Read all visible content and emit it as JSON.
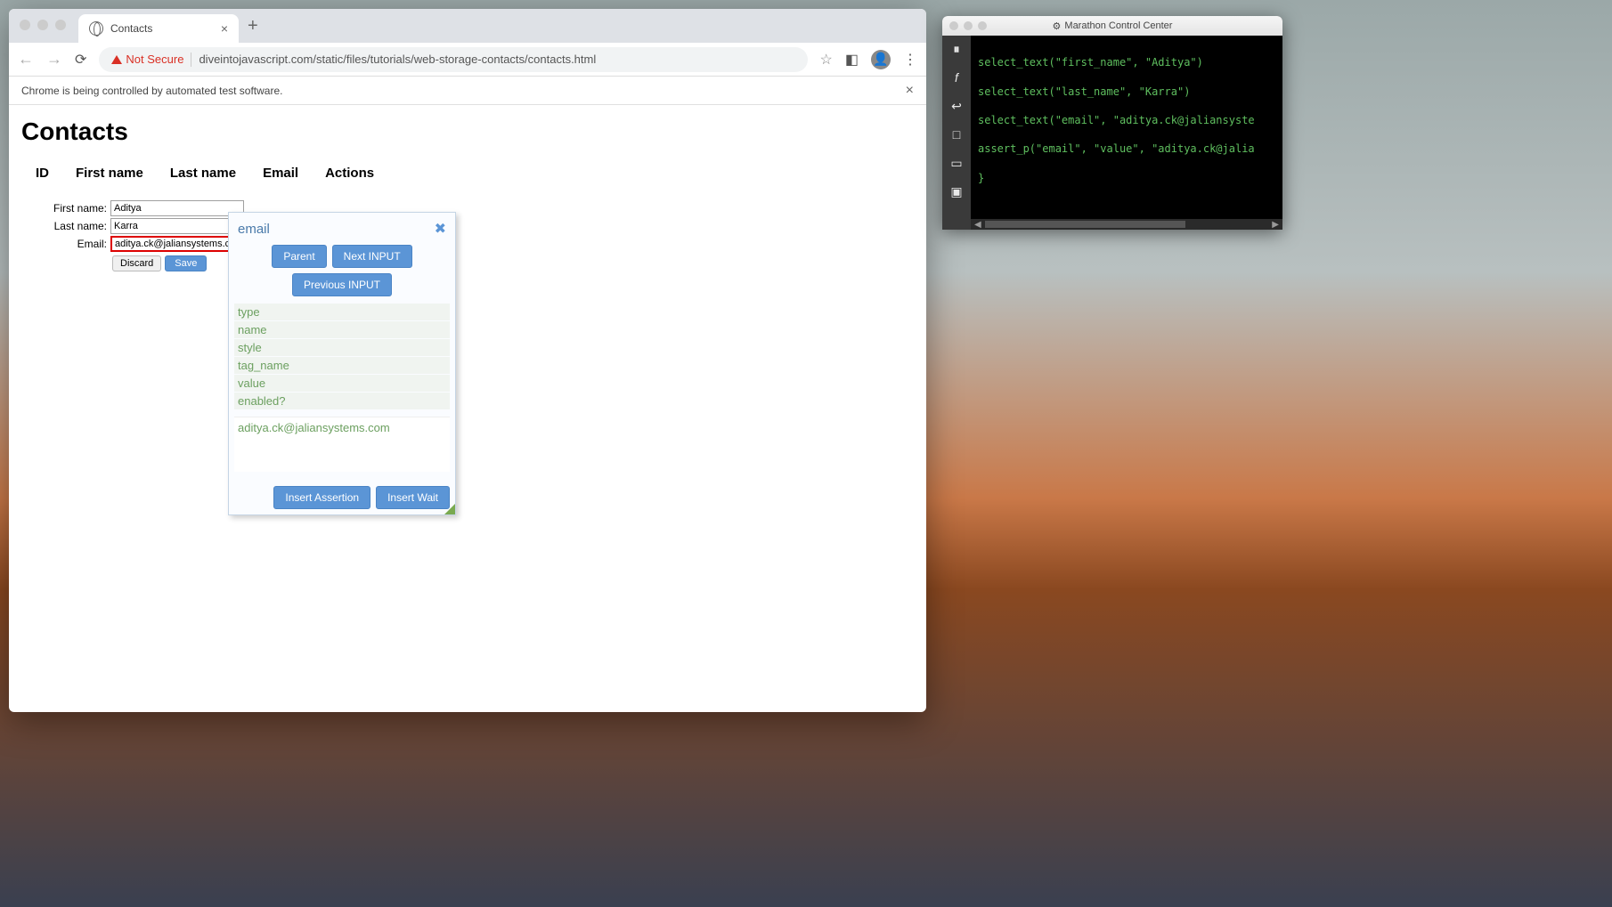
{
  "chrome": {
    "tab_title": "Contacts",
    "security_label": "Not Secure",
    "url": "diveintojavascript.com/static/files/tutorials/web-storage-contacts/contacts.html",
    "infobar_text": "Chrome is being controlled by automated test software."
  },
  "page": {
    "title": "Contacts",
    "headers": {
      "id": "ID",
      "first_name": "First name",
      "last_name": "Last name",
      "email": "Email",
      "actions": "Actions"
    },
    "form": {
      "first_name_label": "First name:",
      "first_name_value": "Aditya",
      "last_name_label": "Last name:",
      "last_name_value": "Karra",
      "email_label": "Email:",
      "email_value": "aditya.ck@jaliansystems.com",
      "discard": "Discard",
      "save": "Save"
    }
  },
  "inspector": {
    "title": "email",
    "nav": {
      "parent": "Parent",
      "next": "Next INPUT",
      "prev": "Previous INPUT"
    },
    "props": [
      "type",
      "name",
      "style",
      "tag_name",
      "value",
      "enabled?"
    ],
    "value_shown": "aditya.ck@jaliansystems.com",
    "actions": {
      "insert_assertion": "Insert Assertion",
      "insert_wait": "Insert Wait"
    }
  },
  "marathon": {
    "title": "Marathon Control Center",
    "code": [
      "select_text(\"first_name\", \"Aditya\")",
      "select_text(\"last_name\", \"Karra\")",
      "select_text(\"email\", \"aditya.ck@jaliansyste",
      "assert_p(\"email\", \"value\", \"aditya.ck@jalia",
      "}"
    ]
  }
}
